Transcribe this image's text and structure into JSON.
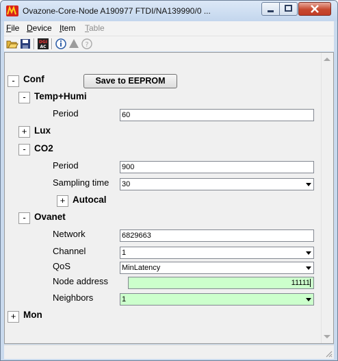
{
  "window": {
    "title": "Ovazone-Core-Node A190977 FTDI/NA139990/0 ...",
    "controls": {
      "minimize": "minimize",
      "maximize": "maximize",
      "close": "close"
    }
  },
  "menu": [
    {
      "label": "File",
      "accel": "F",
      "rest": "ile",
      "enabled": true
    },
    {
      "label": "Device",
      "accel": "D",
      "rest": "evice",
      "enabled": true
    },
    {
      "label": "Item",
      "accel": "I",
      "rest": "tem",
      "enabled": true
    },
    {
      "label": "Table",
      "accel": "T",
      "rest": "able",
      "enabled": false
    }
  ],
  "toolbar": {
    "icons": [
      "open-folder-icon",
      "save-icon",
      "dig-ac-icon",
      "info-icon",
      "warning-icon",
      "help-icon"
    ]
  },
  "tree": {
    "conf": {
      "label": "Conf",
      "toggle": "-",
      "save_button": "Save to EEPROM"
    },
    "temp_humi": {
      "label": "Temp+Humi",
      "toggle": "-",
      "period_label": "Period",
      "period_value": "60"
    },
    "lux": {
      "label": "Lux",
      "toggle": "+"
    },
    "co2": {
      "label": "CO2",
      "toggle": "-",
      "period_label": "Period",
      "period_value": "900",
      "sampling_label": "Sampling time",
      "sampling_value": "30"
    },
    "autocal": {
      "label": "Autocal",
      "toggle": "+"
    },
    "ovanet": {
      "label": "Ovanet",
      "toggle": "-",
      "network_label": "Network",
      "network_value": "6829663",
      "channel_label": "Channel",
      "channel_value": "1",
      "qos_label": "QoS",
      "qos_value": "MinLatency",
      "node_address_label": "Node address",
      "node_address_value": "11111",
      "neighbors_label": "Neighbors",
      "neighbors_value": "1"
    },
    "mon": {
      "label": "Mon",
      "toggle": "+"
    }
  },
  "colors": {
    "highlight_field": "#ccffcc",
    "close_button": "#c7492f",
    "title_bar": "#c9daee"
  }
}
